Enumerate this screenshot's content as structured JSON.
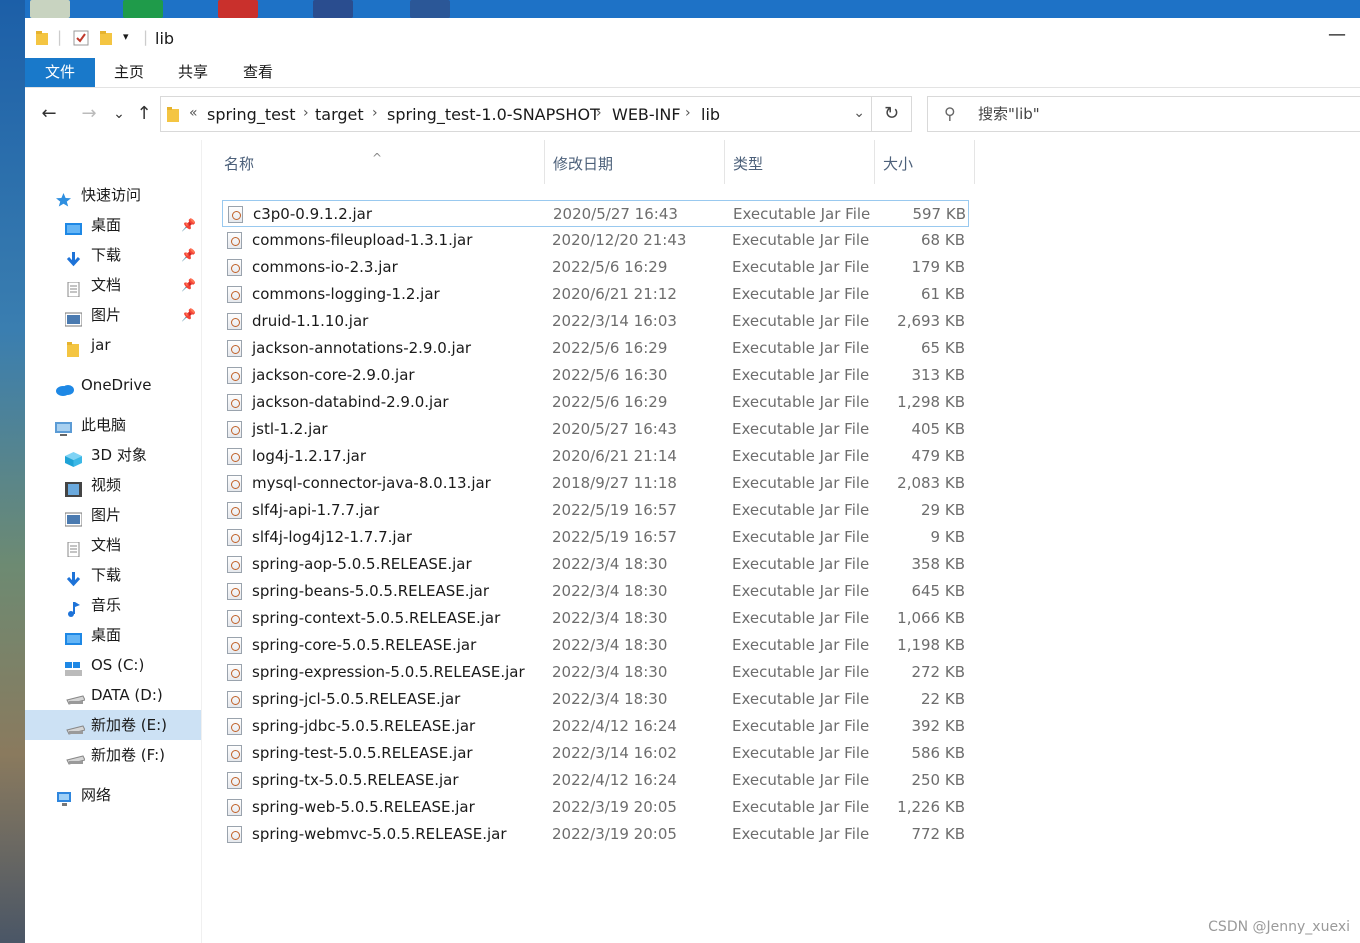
{
  "window": {
    "title": "lib",
    "minimize": "—"
  },
  "ribbon": {
    "tabs": [
      "文件",
      "主页",
      "共享",
      "查看"
    ]
  },
  "nav": {
    "back": "←",
    "forward": "→",
    "recent": "⌄",
    "up": "↑",
    "breadcrumb_prefix": "«",
    "breadcrumbs": [
      "spring_test",
      "target",
      "spring_test-1.0-SNAPSHOT",
      "WEB-INF",
      "lib"
    ],
    "refresh": "↻",
    "search_placeholder": "搜索\"lib\""
  },
  "sidebar": {
    "items": [
      {
        "label": "快速访问",
        "icon": "star-icon",
        "pinned": false
      },
      {
        "label": "桌面",
        "icon": "desktop-icon",
        "pinned": true
      },
      {
        "label": "下载",
        "icon": "download-icon",
        "pinned": true
      },
      {
        "label": "文档",
        "icon": "document-icon",
        "pinned": true
      },
      {
        "label": "图片",
        "icon": "picture-icon",
        "pinned": true
      },
      {
        "label": "jar",
        "icon": "folder-icon",
        "pinned": false
      },
      {
        "label": "OneDrive",
        "icon": "cloud-icon",
        "pinned": false
      },
      {
        "label": "此电脑",
        "icon": "computer-icon",
        "pinned": false
      },
      {
        "label": "3D 对象",
        "icon": "cube-icon",
        "pinned": false
      },
      {
        "label": "视频",
        "icon": "video-icon",
        "pinned": false
      },
      {
        "label": "图片",
        "icon": "picture-icon",
        "pinned": false
      },
      {
        "label": "文档",
        "icon": "document-icon",
        "pinned": false
      },
      {
        "label": "下载",
        "icon": "download-icon",
        "pinned": false
      },
      {
        "label": "音乐",
        "icon": "music-icon",
        "pinned": false
      },
      {
        "label": "桌面",
        "icon": "desktop-icon",
        "pinned": false
      },
      {
        "label": "OS (C:)",
        "icon": "os-drive-icon",
        "pinned": false
      },
      {
        "label": "DATA (D:)",
        "icon": "drive-icon",
        "pinned": false
      },
      {
        "label": "新加卷 (E:)",
        "icon": "drive-icon",
        "pinned": false,
        "selected": true
      },
      {
        "label": "新加卷 (F:)",
        "icon": "drive-icon",
        "pinned": false
      },
      {
        "label": "网络",
        "icon": "network-icon",
        "pinned": false
      }
    ]
  },
  "columns": {
    "name": "名称",
    "date": "修改日期",
    "type": "类型",
    "size": "大小"
  },
  "files": [
    {
      "name": "c3p0-0.9.1.2.jar",
      "date": "2020/5/27 16:43",
      "type": "Executable Jar File",
      "size": "597 KB"
    },
    {
      "name": "commons-fileupload-1.3.1.jar",
      "date": "2020/12/20 21:43",
      "type": "Executable Jar File",
      "size": "68 KB"
    },
    {
      "name": "commons-io-2.3.jar",
      "date": "2022/5/6 16:29",
      "type": "Executable Jar File",
      "size": "179 KB"
    },
    {
      "name": "commons-logging-1.2.jar",
      "date": "2020/6/21 21:12",
      "type": "Executable Jar File",
      "size": "61 KB"
    },
    {
      "name": "druid-1.1.10.jar",
      "date": "2022/3/14 16:03",
      "type": "Executable Jar File",
      "size": "2,693 KB"
    },
    {
      "name": "jackson-annotations-2.9.0.jar",
      "date": "2022/5/6 16:29",
      "type": "Executable Jar File",
      "size": "65 KB"
    },
    {
      "name": "jackson-core-2.9.0.jar",
      "date": "2022/5/6 16:30",
      "type": "Executable Jar File",
      "size": "313 KB"
    },
    {
      "name": "jackson-databind-2.9.0.jar",
      "date": "2022/5/6 16:29",
      "type": "Executable Jar File",
      "size": "1,298 KB"
    },
    {
      "name": "jstl-1.2.jar",
      "date": "2020/5/27 16:43",
      "type": "Executable Jar File",
      "size": "405 KB"
    },
    {
      "name": "log4j-1.2.17.jar",
      "date": "2020/6/21 21:14",
      "type": "Executable Jar File",
      "size": "479 KB"
    },
    {
      "name": "mysql-connector-java-8.0.13.jar",
      "date": "2018/9/27 11:18",
      "type": "Executable Jar File",
      "size": "2,083 KB"
    },
    {
      "name": "slf4j-api-1.7.7.jar",
      "date": "2022/5/19 16:57",
      "type": "Executable Jar File",
      "size": "29 KB"
    },
    {
      "name": "slf4j-log4j12-1.7.7.jar",
      "date": "2022/5/19 16:57",
      "type": "Executable Jar File",
      "size": "9 KB"
    },
    {
      "name": "spring-aop-5.0.5.RELEASE.jar",
      "date": "2022/3/4 18:30",
      "type": "Executable Jar File",
      "size": "358 KB"
    },
    {
      "name": "spring-beans-5.0.5.RELEASE.jar",
      "date": "2022/3/4 18:30",
      "type": "Executable Jar File",
      "size": "645 KB"
    },
    {
      "name": "spring-context-5.0.5.RELEASE.jar",
      "date": "2022/3/4 18:30",
      "type": "Executable Jar File",
      "size": "1,066 KB"
    },
    {
      "name": "spring-core-5.0.5.RELEASE.jar",
      "date": "2022/3/4 18:30",
      "type": "Executable Jar File",
      "size": "1,198 KB"
    },
    {
      "name": "spring-expression-5.0.5.RELEASE.jar",
      "date": "2022/3/4 18:30",
      "type": "Executable Jar File",
      "size": "272 KB"
    },
    {
      "name": "spring-jcl-5.0.5.RELEASE.jar",
      "date": "2022/3/4 18:30",
      "type": "Executable Jar File",
      "size": "22 KB"
    },
    {
      "name": "spring-jdbc-5.0.5.RELEASE.jar",
      "date": "2022/4/12 16:24",
      "type": "Executable Jar File",
      "size": "392 KB"
    },
    {
      "name": "spring-test-5.0.5.RELEASE.jar",
      "date": "2022/3/14 16:02",
      "type": "Executable Jar File",
      "size": "586 KB"
    },
    {
      "name": "spring-tx-5.0.5.RELEASE.jar",
      "date": "2022/4/12 16:24",
      "type": "Executable Jar File",
      "size": "250 KB"
    },
    {
      "name": "spring-web-5.0.5.RELEASE.jar",
      "date": "2022/3/19 20:05",
      "type": "Executable Jar File",
      "size": "1,226 KB"
    },
    {
      "name": "spring-webmvc-5.0.5.RELEASE.jar",
      "date": "2022/3/19 20:05",
      "type": "Executable Jar File",
      "size": "772 KB"
    }
  ],
  "watermark": "CSDN @Jenny_xuexi",
  "colors": {
    "accent": "#1979ca",
    "selected_sidebar": "#cce1f4",
    "selected_row_border": "#99c9ef"
  }
}
